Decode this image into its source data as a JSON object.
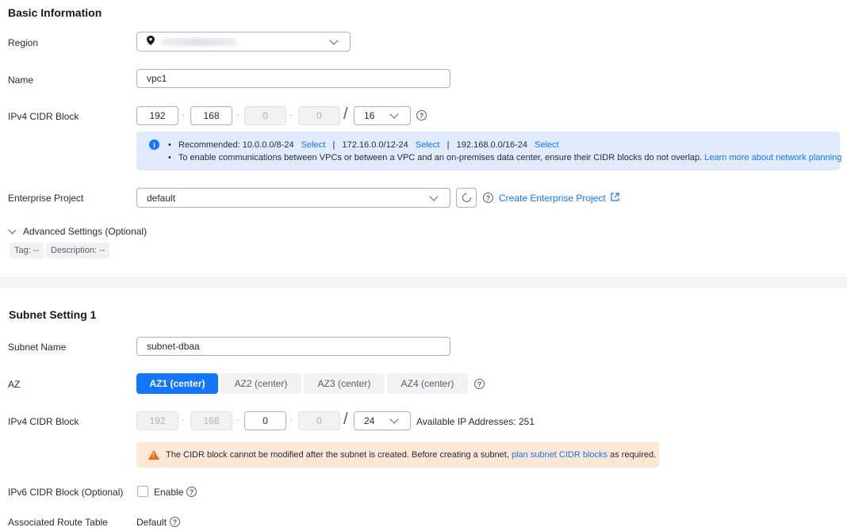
{
  "basic": {
    "title": "Basic Information",
    "region_label": "Region",
    "name_label": "Name",
    "name_value": "vpc1",
    "cidr_label": "IPv4 CIDR Block",
    "cidr": {
      "o1": "192",
      "o2": "168",
      "o3": "0",
      "o4": "0",
      "mask": "16"
    },
    "recommended_prefix": "Recommended: 10.0.0.0/8-24",
    "select_label": "Select",
    "rec2": "172.16.0.0/12-24",
    "rec3": "192.168.0.0/16-24",
    "separator": "|",
    "note": "To enable communications between VPCs or between a VPC and an on-premises data center, ensure their CIDR blocks do not overlap.",
    "learn_more": "Learn more about network planning",
    "enterprise_label": "Enterprise Project",
    "enterprise_value": "default",
    "create_enterprise": "Create Enterprise Project",
    "advanced_label": "Advanced Settings (Optional)",
    "tag_chip": "Tag: --",
    "description_chip": "Description: --"
  },
  "subnet": {
    "title": "Subnet Setting 1",
    "name_label": "Subnet Name",
    "name_value": "subnet-dbaa",
    "az_label": "AZ",
    "az_options": [
      "AZ1 (center)",
      "AZ2 (center)",
      "AZ3 (center)",
      "AZ4 (center)"
    ],
    "az_selected": "AZ1 (center)",
    "cidr_label": "IPv4 CIDR Block",
    "cidr": {
      "o1": "192",
      "o2": "168",
      "o3": "0",
      "o4": "0",
      "mask": "24"
    },
    "available_ips": "Available IP Addresses: 251",
    "warn_text": "The CIDR block cannot be modified after the subnet is created. Before creating a subnet,",
    "warn_link": "plan subnet CIDR blocks",
    "warn_suffix": "as required.",
    "ipv6_label": "IPv6 CIDR Block (Optional)",
    "enable_label": "Enable",
    "route_label": "Associated Route Table",
    "route_value": "Default"
  },
  "colors": {
    "accent": "#1476ff",
    "info_bg": "#e1ebfd",
    "warn_bg": "#fde8d6",
    "warn_icon": "#ea6e18"
  }
}
